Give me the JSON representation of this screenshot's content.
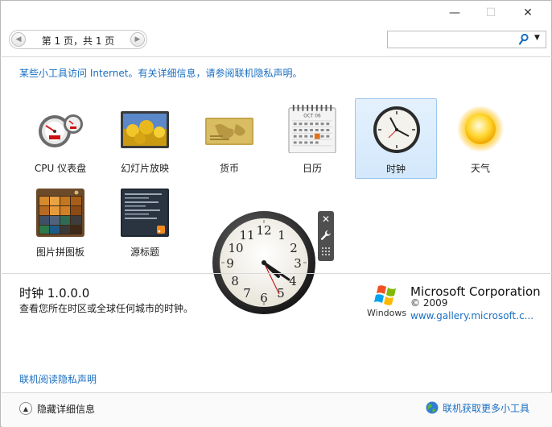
{
  "window": {
    "minimize_glyph": "—",
    "maximize_glyph": "☐",
    "close_glyph": "✕"
  },
  "nav": {
    "prev_glyph": "◀",
    "next_glyph": "▶",
    "page_label": "第 1 页，共 1 页"
  },
  "search": {
    "value": "",
    "dropdown_glyph": "▼"
  },
  "privacy_note": "某些小工具访问 Internet。有关详细信息，请参阅联机隐私声明。",
  "gadgets": [
    {
      "label": "CPU 仪表盘",
      "icon": "cpu-meter-icon",
      "selected": false
    },
    {
      "label": "幻灯片放映",
      "icon": "slideshow-icon",
      "selected": false
    },
    {
      "label": "货币",
      "icon": "currency-icon",
      "selected": false
    },
    {
      "label": "日历",
      "icon": "calendar-icon",
      "selected": false
    },
    {
      "label": "时钟",
      "icon": "clock-icon",
      "selected": true
    },
    {
      "label": "天气",
      "icon": "weather-sun-icon",
      "selected": false
    },
    {
      "label": "图片拼图板",
      "icon": "picture-puzzle-icon",
      "selected": false
    },
    {
      "label": "源标题",
      "icon": "feed-headlines-icon",
      "selected": false
    }
  ],
  "calendar_month": "OCT 06",
  "clock": {
    "numerals": [
      "12",
      "1",
      "2",
      "3",
      "4",
      "5",
      "6",
      "7",
      "8",
      "9",
      "10",
      "11"
    ],
    "tool_close": "✕",
    "tool_options": "🔧",
    "tool_drag": "⋮⋮"
  },
  "details": {
    "title": "时钟 1.0.0.0",
    "description": "查看您所在时区或全球任何城市的时钟。",
    "vendor": "Microsoft Corporation",
    "copyright": "© 2009",
    "vendor_url": "www.gallery.microsoft.c...",
    "logo_word": "Windows"
  },
  "footer": {
    "privacy_link": "联机阅读隐私声明",
    "hide_details": "隐藏详细信息",
    "hide_glyph": "▲",
    "get_more": "联机获取更多小工具"
  },
  "colors": {
    "link": "#1a6fc2",
    "selected_bg": "#d3e8fb",
    "selected_border": "#9bc6ee"
  }
}
